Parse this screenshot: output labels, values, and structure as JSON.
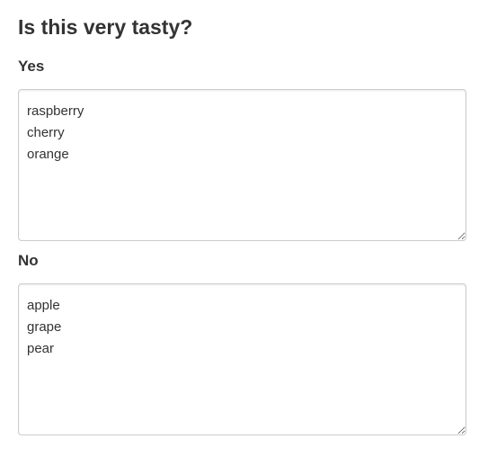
{
  "question": {
    "title": "Is this very tasty?"
  },
  "yes": {
    "label": "Yes",
    "value": "raspberry\ncherry\norange"
  },
  "no": {
    "label": "No",
    "value": "apple\ngrape\npear"
  }
}
